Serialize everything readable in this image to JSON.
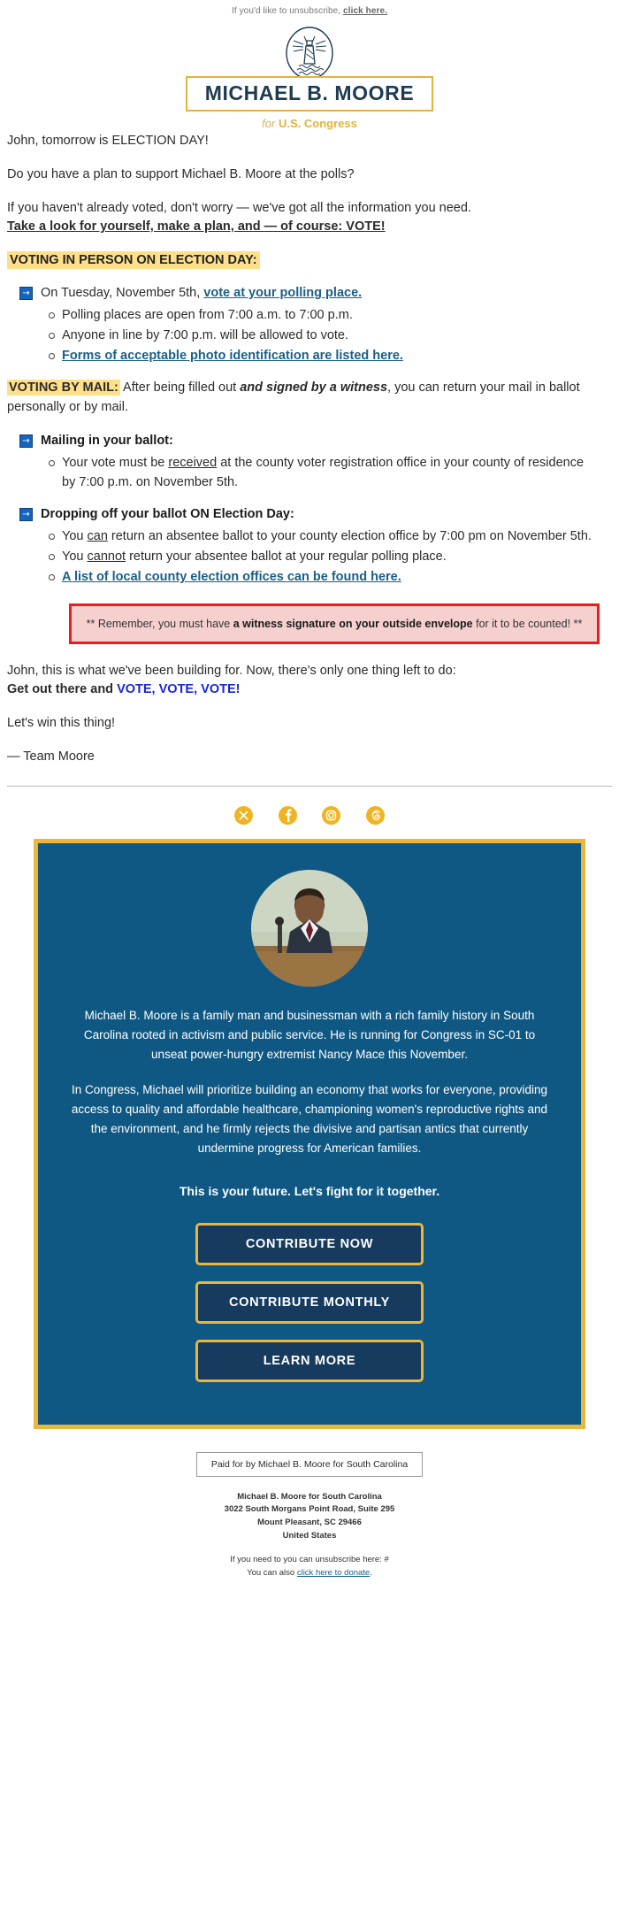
{
  "preheader": {
    "text": "If you'd like to unsubscribe, ",
    "link": "click here."
  },
  "logo": {
    "icon": "lighthouse-icon",
    "name": "MICHAEL B. MOORE",
    "sub_italic": "for ",
    "sub_bold": "U.S. Congress",
    "border_color": "#e3b33c",
    "name_color": "#1f3b52"
  },
  "body": {
    "greeting": "John, tomorrow is ELECTION DAY!",
    "question": "Do you have a plan to support Michael B. Moore at the polls?",
    "intro": "If you haven't already voted, don't worry — we've got all the information you need.",
    "intro_bold": "Take a look for yourself, make a plan, and — of course: VOTE!"
  },
  "in_person": {
    "heading": "VOTING IN PERSON ON ELECTION DAY:",
    "heading_bg": "#ffe08a",
    "item_lead": "On Tuesday, November 5th, ",
    "item_link": "vote at your polling place.",
    "subs": [
      "Polling places are open from 7:00 a.m. to 7:00 p.m.",
      "Anyone in line by 7:00 p.m. will be allowed to vote."
    ],
    "sub_link": "Forms of acceptable photo identification are listed here."
  },
  "by_mail": {
    "heading": "VOTING BY MAIL:",
    "text_a": " After being filled out ",
    "text_italic": "and signed by a witness",
    "text_b": ", you can return your mail in ballot personally or by mail."
  },
  "mailing": {
    "heading": "Mailing in your ballot:",
    "sub_a": "Your vote must be ",
    "sub_underline": "received",
    "sub_b": " at the county voter registration office in your county of residence by 7:00 p.m. on November 5th."
  },
  "dropoff": {
    "heading": "Dropping off your ballot ON Election Day:",
    "sub1_a": "You ",
    "sub1_u": "can",
    "sub1_b": " return an absentee ballot to your county election office by 7:00 pm on November 5th.",
    "sub2_a": "You ",
    "sub2_u": "cannot",
    "sub2_b": " return your absentee ballot at your regular polling place.",
    "sub3_link": "A list of local county election offices can be found here."
  },
  "warning": {
    "pre": "** Remember, you must have ",
    "bold": "a witness signature on your outside envelope",
    "post": " for it to be counted! **",
    "border_color": "#ee1b1b",
    "bg_color": "#f6cfcf"
  },
  "closing": {
    "line1": "John, this is what we've been building for. Now, there's only one thing left to do:",
    "line2_a": "Get out there and ",
    "line2_vote": "VOTE, VOTE, VOTE!",
    "vote_color": "#1a26d8",
    "line3": "Let's win this thing!",
    "signoff": "— Team Moore"
  },
  "social": {
    "icons": [
      "x-icon",
      "facebook-icon",
      "instagram-icon",
      "threads-icon"
    ],
    "color": "#f0b323"
  },
  "card": {
    "bg": "#0f5884",
    "border": "#e9b73c",
    "portrait_alt": "candidate-portrait",
    "para1": "Michael B. Moore is a family man and businessman with a rich family history in South Carolina rooted in activism and public service. He is running for Congress in SC-01 to unseat power-hungry extremist Nancy Mace this November.",
    "para2": "In Congress, Michael will prioritize building an economy that works for everyone, providing access to quality and affordable healthcare, championing women's reproductive rights and the environment, and he firmly rejects the divisive and partisan antics that currently undermine progress for American families.",
    "tagline": "This is your future. Let's fight for it together.",
    "buttons": [
      "CONTRIBUTE NOW",
      "CONTRIBUTE MONTHLY",
      "LEARN MORE"
    ]
  },
  "footer": {
    "paid_for": "Paid for by Michael B. Moore for South Carolina",
    "address": [
      "Michael B. Moore for South Carolina",
      "3022 South Morgans Point Road, Suite 295",
      "Mount Pleasant, SC 29466",
      "United States"
    ],
    "unsub_a": "If you need to you can unsubscribe here: #",
    "unsub_b_pre": "You can also ",
    "unsub_b_link": "click here to donate",
    "unsub_b_post": "."
  }
}
